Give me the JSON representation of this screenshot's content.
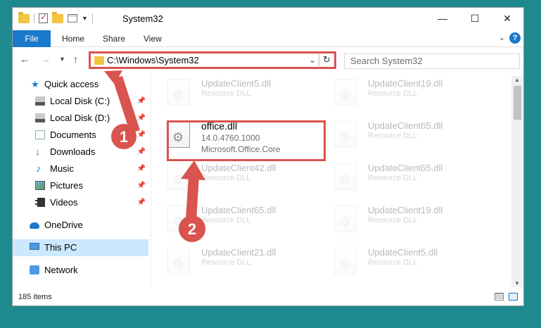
{
  "window": {
    "title": "System32",
    "controls": {
      "minimize": "—",
      "maximize": "☐",
      "close": "✕"
    }
  },
  "ribbon": {
    "file": "File",
    "tabs": [
      "Home",
      "Share",
      "View"
    ],
    "help": "?"
  },
  "nav": {
    "address": "C:\\Windows\\System32",
    "search_placeholder": "Search System32"
  },
  "sidebar": {
    "items": [
      {
        "label": "Quick access",
        "icon": "star-icon",
        "pinned": false
      },
      {
        "label": "Local Disk (C:)",
        "icon": "drive-icon",
        "pinned": true
      },
      {
        "label": "Local Disk (D:)",
        "icon": "drive-icon",
        "pinned": true
      },
      {
        "label": "Documents",
        "icon": "documents-icon",
        "pinned": true
      },
      {
        "label": "Downloads",
        "icon": "downloads-icon",
        "pinned": true
      },
      {
        "label": "Music",
        "icon": "music-icon",
        "pinned": true
      },
      {
        "label": "Pictures",
        "icon": "pictures-icon",
        "pinned": true
      },
      {
        "label": "Videos",
        "icon": "videos-icon",
        "pinned": true
      },
      {
        "label": "OneDrive",
        "icon": "onedrive-icon",
        "pinned": false
      },
      {
        "label": "This PC",
        "icon": "this-pc-icon",
        "pinned": false,
        "selected": true
      },
      {
        "label": "Network",
        "icon": "network-icon",
        "pinned": false
      }
    ]
  },
  "files": {
    "left": [
      {
        "name": "UpdateClient5.dll",
        "type": "Resource DLL"
      },
      {
        "name": "office.dll",
        "version": "14.0.4760.1000",
        "company": "Microsoft.Office.Core"
      },
      {
        "name": "UpdateClient42.dll",
        "type": "Resource DLL"
      },
      {
        "name": "UpdateClient65.dll",
        "type": "Resource DLL"
      },
      {
        "name": "UpdateClient21.dll",
        "type": "Resource DLL"
      }
    ],
    "right": [
      {
        "name": "UpdateClient19.dll",
        "type": "Resource DLL"
      },
      {
        "name": "UpdateClient65.dll",
        "type": "Resource DLL"
      },
      {
        "name": "UpdateClient65.dll",
        "type": "Resource DLL"
      },
      {
        "name": "UpdateClient19.dll",
        "type": "Resource DLL"
      },
      {
        "name": "UpdateClient5.dll",
        "type": "Resource DLL"
      }
    ]
  },
  "status": {
    "item_count": "185 items"
  },
  "annotations": {
    "step1": "1",
    "step2": "2",
    "color": "#d9534f"
  }
}
